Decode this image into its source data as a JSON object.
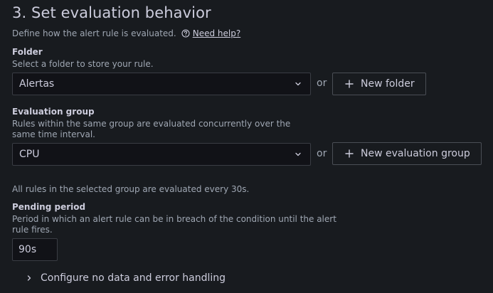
{
  "section": {
    "title": "3. Set evaluation behavior",
    "description": "Define how the alert rule is evaluated.",
    "help_link": "Need help?"
  },
  "folder": {
    "label": "Folder",
    "description": "Select a folder to store your rule.",
    "selected": "Alertas",
    "or_text": "or",
    "new_button": "New folder"
  },
  "evaluation_group": {
    "label": "Evaluation group",
    "description": "Rules within the same group are evaluated concurrently over the same time interval.",
    "selected": "CPU",
    "or_text": "or",
    "new_button": "New evaluation group",
    "info": "All rules in the selected group are evaluated every 30s."
  },
  "pending_period": {
    "label": "Pending period",
    "description": "Period in which an alert rule can be in breach of the condition until the alert rule fires.",
    "value": "90s"
  },
  "collapse": {
    "label": "Configure no data and error handling"
  },
  "icons": {
    "help": "question-circle-icon",
    "chevron": "chevron-down-icon",
    "plus": "plus-icon",
    "expand": "chevron-right-icon"
  },
  "colors": {
    "background": "#181b1f",
    "input_background": "#111217",
    "text_primary": "#ccccdc",
    "text_secondary": "#9fa7b3",
    "border": "#3a3d44"
  }
}
